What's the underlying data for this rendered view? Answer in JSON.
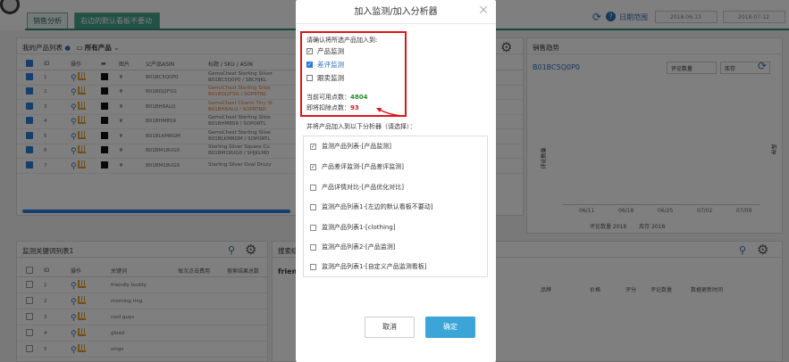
{
  "header": {
    "tabs": [
      "销售分析",
      "右边的默认看板不要动"
    ],
    "date_range_label": "日期范围",
    "date_start": "2018-06-13",
    "date_end": "2018-07-12"
  },
  "products_panel": {
    "title": "我的产品列表",
    "filter_label": "所有产品",
    "columns": [
      "ID",
      "操作",
      "",
      "图片",
      "父产品ASIN",
      "标题 / SKU / ASIN"
    ],
    "rows": [
      {
        "id": "1",
        "parent_asin": "B01BC5Q0P0",
        "title": "GemsChest Sterling Silver",
        "sku": "B01BC5Q0P0 / SBCHJKL"
      },
      {
        "id": "2",
        "parent_asin": "B01BDJ2FSG",
        "title": "GemsChest Sterling Silve",
        "sku": "B01BDJ2FSG / SOPRTBC"
      },
      {
        "id": "3",
        "parent_asin": "B01BH6ALQ",
        "title": "GemsChest Charm Tiny St",
        "sku": "B01BH6ALQ / SOPRTBD"
      },
      {
        "id": "4",
        "parent_asin": "B01BHM8S9",
        "title": "GemsChest Sterling Silve",
        "sku": "B01BHM8S9 / SOPORTL"
      },
      {
        "id": "5",
        "parent_asin": "B01BLKMRGM",
        "title": "GemsChest Sterling Silve",
        "sku": "B01BLKMRGM / SOPORTL"
      },
      {
        "id": "6",
        "parent_asin": "B01BM18UG0",
        "title": "Sterling Silver Square Cu",
        "sku": "B01BM18UG0 / SHJKLMD"
      },
      {
        "id": "7",
        "parent_asin": "B01BM18UG0",
        "title": "Sterling Silver Oval Druzy",
        "sku": ""
      }
    ]
  },
  "sales_panel": {
    "title": "销售趋势",
    "asin": "B01BC5Q0P0",
    "select1": "评论数量",
    "select2": "库存",
    "y_left": "评论数量",
    "y_right": "库存",
    "x_ticks": [
      "06/11",
      "06/18",
      "06/25",
      "07/02",
      "07/09"
    ],
    "legend": [
      "评论数量 2018",
      "库存 2018"
    ]
  },
  "keywords_panel": {
    "title": "监测关键词列表1",
    "columns": [
      "ID",
      "操作",
      "关键词",
      "每次点击费用",
      "搜索结果总数"
    ],
    "rows": [
      {
        "id": "1",
        "keyword": "friendly buddy"
      },
      {
        "id": "2",
        "keyword": "morning ring"
      },
      {
        "id": "3",
        "keyword": "cool guys"
      },
      {
        "id": "4",
        "keyword": "gload"
      },
      {
        "id": "5",
        "keyword": "sings"
      }
    ]
  },
  "search_panel": {
    "title": "搜索结",
    "keyword": "friend",
    "columns": [
      "品牌",
      "价格",
      "评分",
      "评论数量",
      "数据更新时间"
    ]
  },
  "modal": {
    "title": "加入监测/加入分析器",
    "prompt": "请确认将所选产品加入到:",
    "options": [
      {
        "label": "产品监测",
        "checked": true
      },
      {
        "label": "差评监测",
        "checked": true
      },
      {
        "label": "跟卖监测",
        "checked": false
      }
    ],
    "points_available_label": "当前可用点数：",
    "points_available": "4804",
    "points_deduct_label": "即将扣除点数：",
    "points_deduct": "93",
    "analyzer_prompt": "并将产品加入到以下分析器（请选择）：",
    "analyzers": [
      {
        "label": "监测产品列表-[产品监测]",
        "checked": true
      },
      {
        "label": "产品差评监测-[产品差评监测]",
        "checked": true
      },
      {
        "label": "产品详情对比-[产品优化对比]",
        "checked": false
      },
      {
        "label": "监测产品列表1-[左边的默认看板不要动]",
        "checked": false
      },
      {
        "label": "监测产品列表1-[clothing]",
        "checked": false
      },
      {
        "label": "监测产品列表2-[产品监测]",
        "checked": false
      },
      {
        "label": "监测产品列表1-[自定义产品监测看板]",
        "checked": false
      }
    ],
    "cancel_label": "取消",
    "ok_label": "确定"
  },
  "colors": {
    "accent": "#2f8a73",
    "primary_blue": "#3aa5d6",
    "highlight_red": "#d9161c"
  }
}
